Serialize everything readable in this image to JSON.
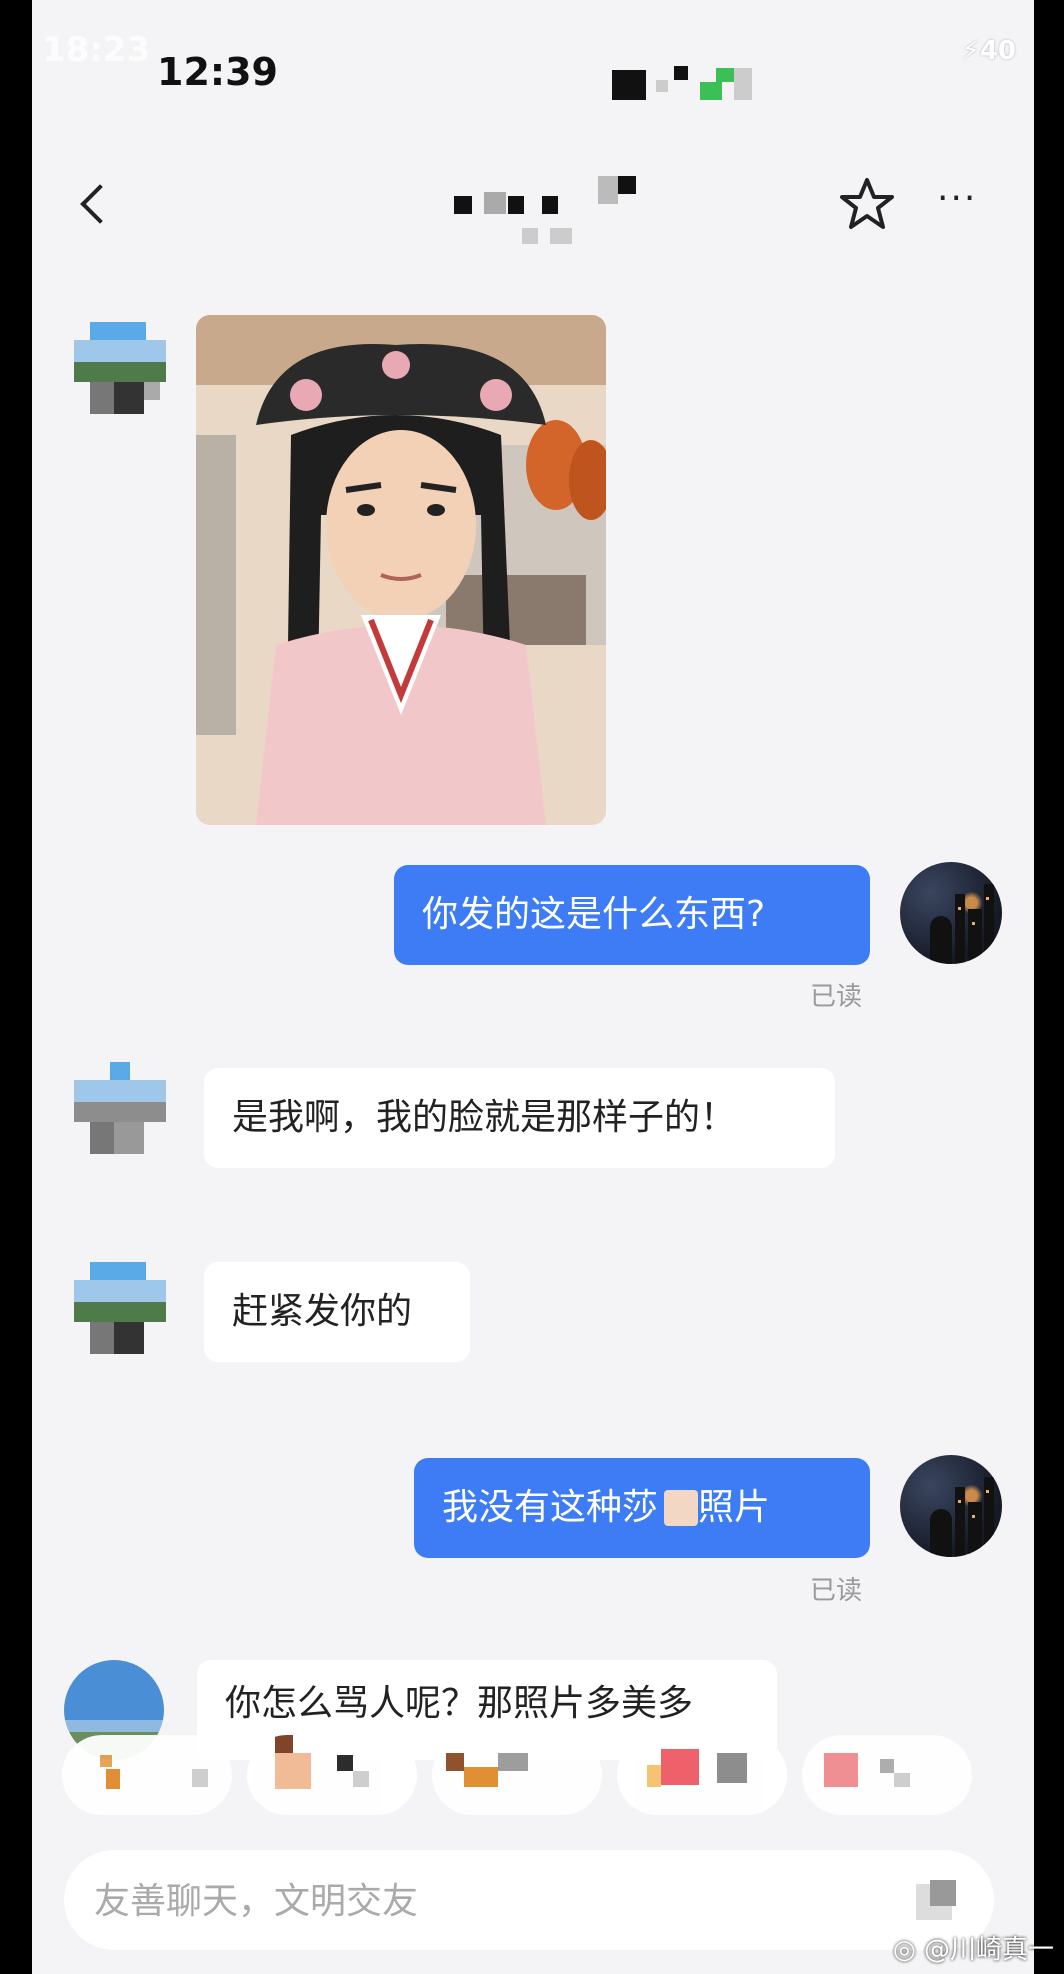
{
  "status_bar": {
    "ghost_time": "18:23",
    "time": "12:39",
    "battery": "40"
  },
  "header": {
    "title": ""
  },
  "messages": [
    {
      "side": "in",
      "type": "image"
    },
    {
      "side": "out",
      "text": "你发的这是什么东西?",
      "read": "已读"
    },
    {
      "side": "in",
      "text": "是我啊，我的脸就是那样子的！"
    },
    {
      "side": "in",
      "text": "赶紧发你的"
    },
    {
      "side": "out",
      "text": "我没有这种莎",
      "text_after": " 照片",
      "read": "已读"
    },
    {
      "side": "in",
      "text": "你怎么骂人呢？那照片多美多"
    }
  ],
  "input": {
    "placeholder": "友善聊天，文明交友"
  },
  "watermark": "@川崎真一",
  "colors": {
    "accent": "#3d7cf5",
    "background": "#f4f4f6"
  },
  "icons": [
    "back-icon",
    "star-icon",
    "more-icon",
    "send-icon",
    "weibo-icon"
  ]
}
